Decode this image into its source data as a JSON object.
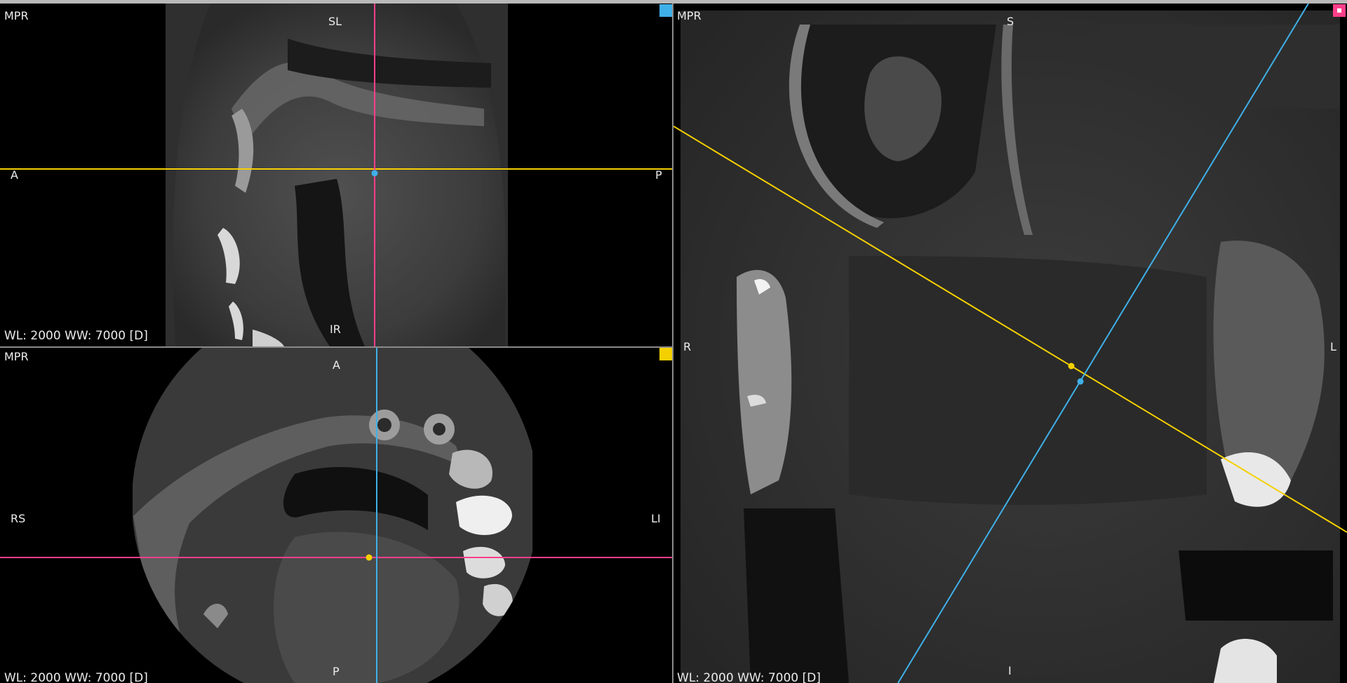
{
  "colors": {
    "blue": "#3fb0e8",
    "yellow": "#f5d000",
    "pink": "#ff3f8a"
  },
  "sagittal": {
    "mode": "MPR",
    "top": "SL",
    "bottom": "IR",
    "left": "A",
    "right": "P",
    "status": "WL: 2000 WW: 7000 [D]",
    "marker_color": "#3fb0e8"
  },
  "axial": {
    "mode": "MPR",
    "top": "A",
    "bottom": "P",
    "left": "RS",
    "right": "LI",
    "status": "WL: 2000 WW: 7000 [D]",
    "marker_color": "#f5d000"
  },
  "coronal": {
    "mode": "MPR",
    "top": "S",
    "bottom": "I",
    "left": "R",
    "right": "L",
    "status": "WL: 2000 WW: 7000 [D]",
    "marker_color": "#ff3f8a"
  }
}
